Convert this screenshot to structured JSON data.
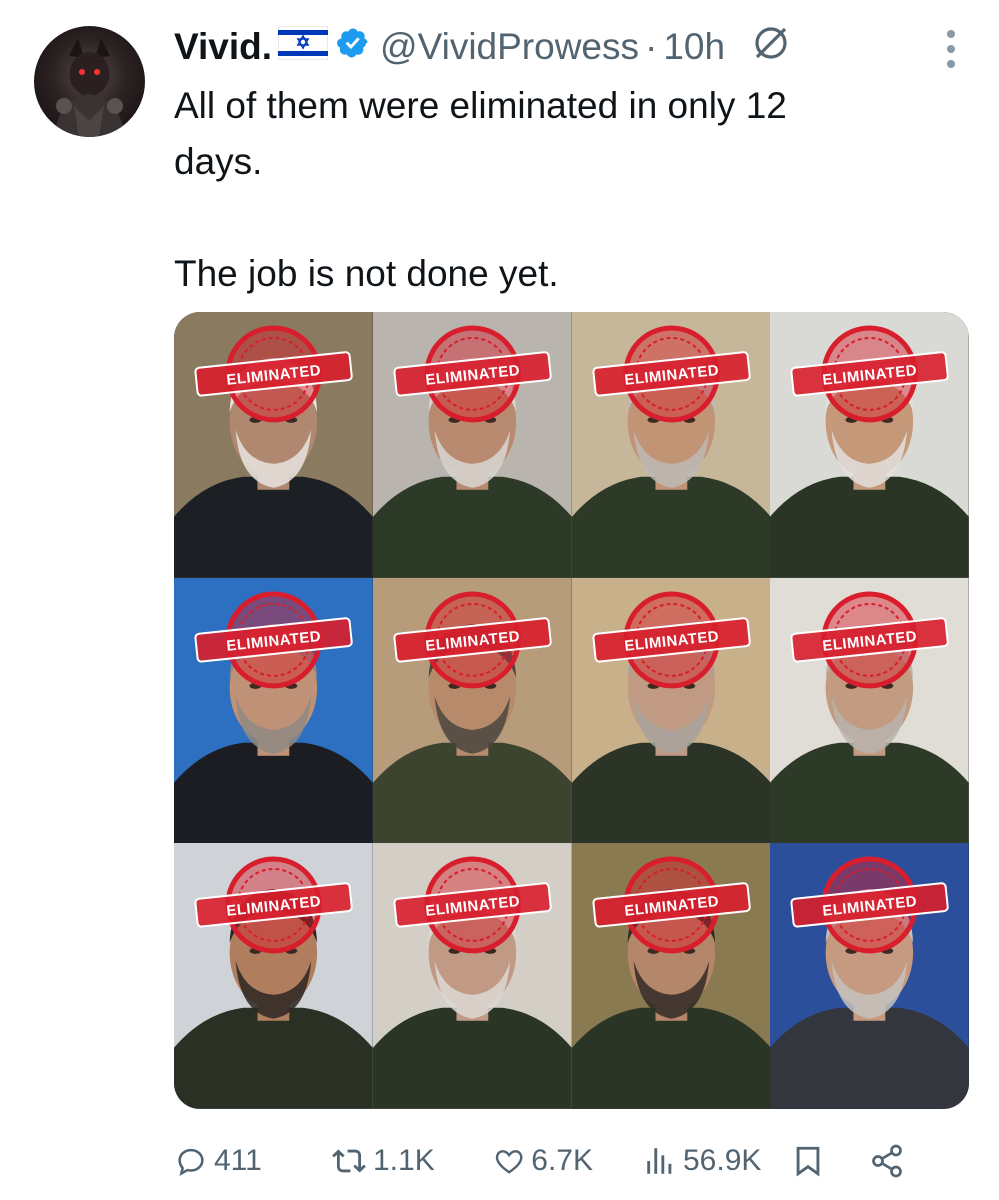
{
  "author": {
    "name": "Vivid.",
    "handle": "@VividProwess",
    "separator": "·",
    "time": "10h"
  },
  "post": {
    "text": "All of them were eliminated in only 12\ndays.\n\nThe job is not done yet."
  },
  "media": {
    "stamp_text": "ELIMINATED",
    "tiles": [
      {
        "stamp": "ELIMINATED",
        "bg": "#8a7a60",
        "uniform": "#1c1f24",
        "skin": "#b08870",
        "hair": "#e8e4df"
      },
      {
        "stamp": "ELIMINATED",
        "bg": "#b9b4ad",
        "uniform": "#2e3a28",
        "skin": "#b88b70",
        "hair": "#d8d6d2"
      },
      {
        "stamp": "ELIMINATED",
        "bg": "#c6b79a",
        "uniform": "#2e3a28",
        "skin": "#c09475",
        "hair": "#bdbab5"
      },
      {
        "stamp": "ELIMINATED",
        "bg": "#d9dad6",
        "uniform": "#2a3526",
        "skin": "#c49878",
        "hair": "#e3e1dd"
      },
      {
        "stamp": "ELIMINATED",
        "bg": "#2d6fc0",
        "uniform": "#1b1d22",
        "skin": "#bf9176",
        "hair": "#8f8a84"
      },
      {
        "stamp": "ELIMINATED",
        "bg": "#b69c7a",
        "uniform": "#3c4430",
        "skin": "#b88a6c",
        "hair": "#4a4540"
      },
      {
        "stamp": "ELIMINATED",
        "bg": "#c8b08a",
        "uniform": "#2b3427",
        "skin": "#c09a82",
        "hair": "#a8a39d"
      },
      {
        "stamp": "ELIMINATED",
        "bg": "#e0dcd6",
        "uniform": "#2e3a28",
        "skin": "#c29b80",
        "hair": "#b8b4ae"
      },
      {
        "stamp": "ELIMINATED",
        "bg": "#cfd2d6",
        "uniform": "#2a3024",
        "skin": "#b07d5f",
        "hair": "#2b2622"
      },
      {
        "stamp": "ELIMINATED",
        "bg": "#d4cfc6",
        "uniform": "#2a3526",
        "skin": "#c09a85",
        "hair": "#dcd9d4"
      },
      {
        "stamp": "ELIMINATED",
        "bg": "#8a7a52",
        "uniform": "#2a3526",
        "skin": "#b4876a",
        "hair": "#302a26"
      },
      {
        "stamp": "ELIMINATED",
        "bg": "#2c4f9c",
        "uniform": "#33363c",
        "skin": "#c69a80",
        "hair": "#c4c2bf"
      }
    ]
  },
  "actions": {
    "replies": "411",
    "reposts": "1.1K",
    "likes": "6.7K",
    "views": "56.9K"
  },
  "colors": {
    "text": "#0f1419",
    "secondary": "#536471",
    "verified": "#1d9bf0",
    "stamp": "#d81e2c"
  }
}
